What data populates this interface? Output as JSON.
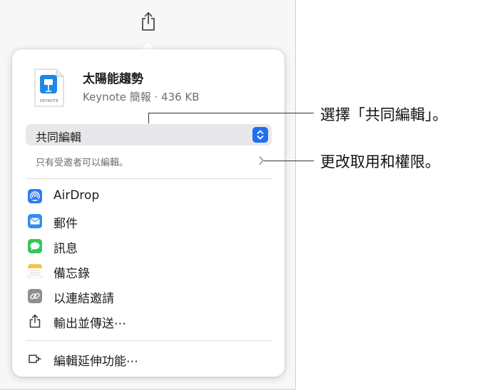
{
  "file": {
    "title": "太陽能趨勢",
    "subtitle": "Keynote 簡報 · 436 KB",
    "icon_label": "KEYNOTE"
  },
  "collaboration": {
    "selected": "共同編輯",
    "permission_text": "只有受邀者可以編輯。"
  },
  "menu": {
    "items": [
      {
        "label": "AirDrop",
        "icon": "airdrop-icon"
      },
      {
        "label": "郵件",
        "icon": "mail-icon"
      },
      {
        "label": "訊息",
        "icon": "messages-icon"
      },
      {
        "label": "備忘錄",
        "icon": "notes-icon"
      },
      {
        "label": "以連結邀請",
        "icon": "link-icon"
      },
      {
        "label": "輸出並傳送⋯",
        "icon": "export-icon"
      }
    ],
    "extensions_label": "編輯延伸功能⋯"
  },
  "callouts": {
    "collab": "選擇「共同編輯」。",
    "permissions": "更改取用和權限。"
  },
  "colors": {
    "accent": "#1f6ff2",
    "airdrop": "#2e7cf6",
    "mail": "#2f8df5",
    "messages": "#34c759",
    "notes": "#f5c542",
    "link": "#8e8e93"
  }
}
